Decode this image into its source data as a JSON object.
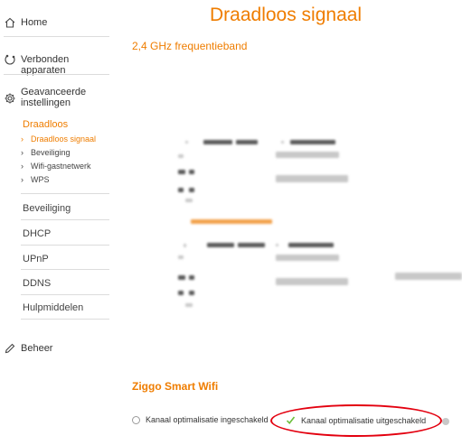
{
  "header": {
    "title": "Draadloos signaal"
  },
  "sidebar": {
    "home": {
      "label": "Home",
      "icon": "home-icon"
    },
    "devices": {
      "label": "Verbonden apparaten",
      "icon": "devices-icon"
    },
    "advanced": {
      "label_line1": "Geavanceerde",
      "label_line2": "instellingen",
      "icon": "gear-icon"
    },
    "wireless_section": {
      "label": "Draadloos",
      "items": [
        {
          "label": "Draadloos signaal",
          "active": true
        },
        {
          "label": "Beveiliging"
        },
        {
          "label": "Wifi-gastnetwerk"
        },
        {
          "label": "WPS"
        }
      ]
    },
    "sections": [
      {
        "label": "Beveiliging"
      },
      {
        "label": "DHCP"
      },
      {
        "label": "UPnP"
      },
      {
        "label": "DDNS"
      },
      {
        "label": "Hulpmiddelen"
      }
    ],
    "manage": {
      "label": "Beheer",
      "icon": "pencil-icon"
    }
  },
  "main": {
    "band_title": "2,4 GHz frequentieband",
    "smart_wifi": {
      "title": "Ziggo Smart Wifi",
      "option_on": "Kanaal optimalisatie ingeschakeld",
      "option_off": "Kanaal optimalisatie uitgeschakeld",
      "selected": "option_off"
    }
  },
  "colors": {
    "accent": "#ef7d00",
    "annotation": "#e3000f",
    "check": "#6bbf3a"
  }
}
